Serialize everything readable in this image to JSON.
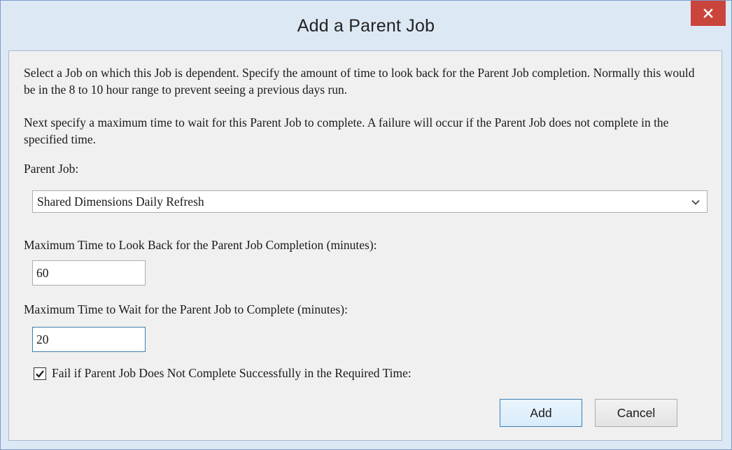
{
  "window": {
    "title": "Add a Parent Job",
    "close_icon": "close-icon"
  },
  "description": {
    "paragraph1": "Select a Job on which this Job is dependent. Specify the amount of time to look back for the Parent Job completion. Normally this would be in the 8 to 10 hour range to prevent seeing a previous days run.",
    "paragraph2": "Next specify a maximum time to wait for this Parent Job to complete. A failure will occur if the Parent Job does not complete in the specified time."
  },
  "parent_job": {
    "label": "Parent Job:",
    "selected": "Shared Dimensions Daily Refresh",
    "arrow_icon": "chevron-down-icon"
  },
  "look_back": {
    "label": "Maximum Time to Look Back for the Parent Job Completion (minutes):",
    "value": "60"
  },
  "wait_time": {
    "label": "Maximum Time to Wait for the Parent Job to Complete (minutes):",
    "value": "20"
  },
  "fail_checkbox": {
    "label": "Fail if Parent Job Does Not Complete Successfully in the Required Time:",
    "checked": true
  },
  "buttons": {
    "add": "Add",
    "cancel": "Cancel"
  },
  "colors": {
    "close_button": "#c9443a",
    "title_background": "#dde8f5",
    "client_background": "#f0f0f0",
    "focus_border": "#3c7fb1"
  }
}
